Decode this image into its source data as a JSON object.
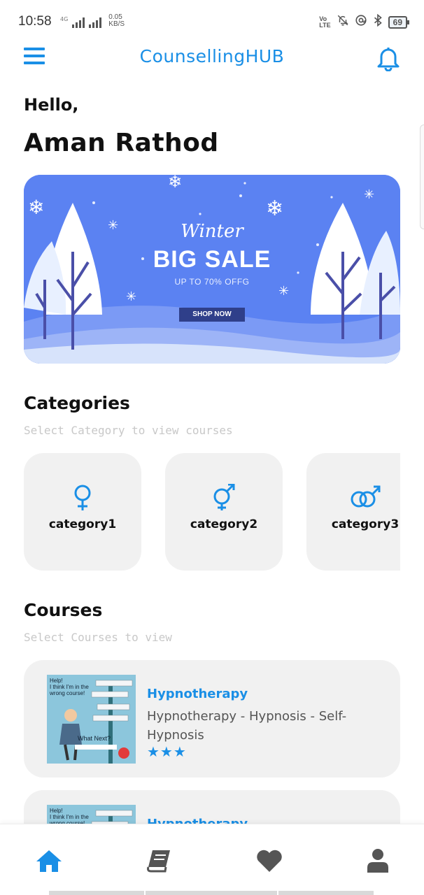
{
  "status": {
    "time": "10:58",
    "network_tag": "4G",
    "speed_value": "0.05",
    "speed_unit": "KB/S",
    "volte_top": "Vo",
    "volte_bottom": "LTE",
    "battery": "69"
  },
  "header": {
    "title": "CounsellingHUB"
  },
  "greeting": {
    "hello": "Hello,",
    "name": "Aman Rathod"
  },
  "banner": {
    "script": "Winter",
    "title": "BIG SALE",
    "subtitle": "UP TO 70% OFFG",
    "button": "SHOP NOW"
  },
  "categories": {
    "title": "Categories",
    "subtitle": "Select Category to view courses",
    "items": [
      {
        "label": "category1",
        "icon": "female-symbol-icon"
      },
      {
        "label": "category2",
        "icon": "transgender-symbol-icon"
      },
      {
        "label": "category3",
        "icon": "couple-symbol-icon"
      }
    ]
  },
  "courses": {
    "title": "Courses",
    "subtitle": "Select Courses to view",
    "items": [
      {
        "name": "Hypnotherapy",
        "description": "Hypnotherapy - Hypnosis - Self-Hypnosis",
        "stars": "★★★",
        "thumb_lines": [
          "Help!",
          "I think I'm in the",
          "wrong course!",
          "What Next?"
        ]
      },
      {
        "name": "Hypnotherapy",
        "thumb_lines": [
          "Help!",
          "I think I'm in the",
          "wrong course!"
        ]
      }
    ]
  },
  "bottom_nav": [
    {
      "icon": "home-icon",
      "active": true
    },
    {
      "icon": "book-icon",
      "active": false
    },
    {
      "icon": "heart-icon",
      "active": false
    },
    {
      "icon": "profile-icon",
      "active": false
    }
  ],
  "colors": {
    "accent": "#1a8fe6",
    "card_bg": "#f1f1f1",
    "banner_bg": "#5b82f2",
    "muted": "#c8c8c8"
  }
}
